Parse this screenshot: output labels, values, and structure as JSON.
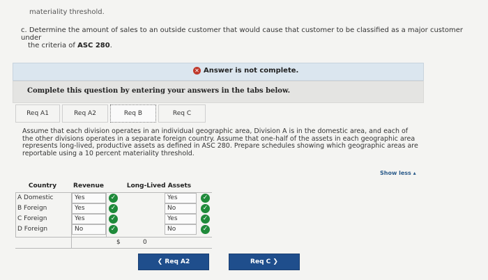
{
  "top_text": "materiality threshold.",
  "question_c": {
    "line1": "c. Determine the amount of sales to an outside customer that would cause that customer to be classified as a major customer under",
    "line2_prefix": "the criteria of ",
    "line2_bold": "ASC 280",
    "line2_suffix": "."
  },
  "answer_status": "Answer is not complete.",
  "instruction": "Complete this question by entering your answers in the tabs below.",
  "tabs": [
    {
      "label": "Req A1"
    },
    {
      "label": "Req A2"
    },
    {
      "label": "Req B"
    },
    {
      "label": "Req C"
    }
  ],
  "active_tab": "Req B",
  "assumption": "Assume that each division operates in an individual geographic area, Division A is in the domestic area, and each of the other divisions operates in a separate foreign country. Assume that one-half of the assets in each geographic area represents long-lived, productive assets as defined in ASC 280. Prepare schedules showing which geographic areas are reportable using a 10 percent materiality threshold.",
  "show_less": "Show less ▴",
  "table": {
    "headers": {
      "country": "Country",
      "revenue": "Revenue",
      "assets": "Long-Lived Assets"
    },
    "rows": [
      {
        "country": "A Domestic",
        "revenue": "Yes",
        "assets": "Yes"
      },
      {
        "country": "B Foreign",
        "revenue": "Yes",
        "assets": "No"
      },
      {
        "country": "C Foreign",
        "revenue": "Yes",
        "assets": "Yes"
      },
      {
        "country": "D Foreign",
        "revenue": "No",
        "assets": "No"
      }
    ],
    "footer": {
      "currency": "$",
      "value": "0"
    }
  },
  "nav": {
    "prev": "❮  Req A2",
    "next": "Req C  ❯"
  },
  "colors": {
    "check": "#1f8a3a",
    "error": "#c0392b",
    "nav": "#1f4e8c"
  }
}
